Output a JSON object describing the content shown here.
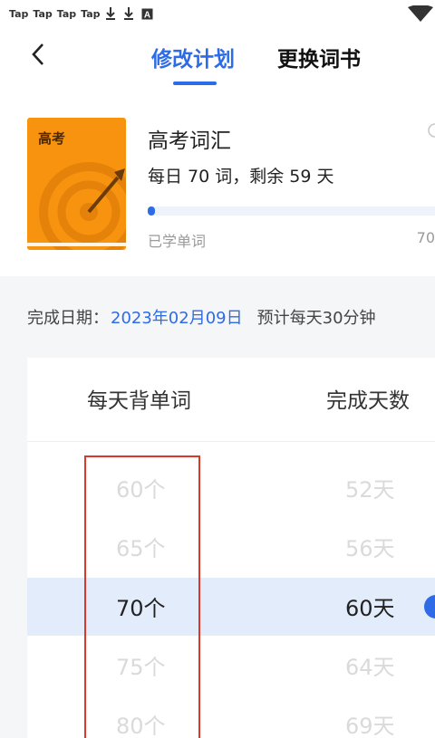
{
  "status_bar": {
    "tap_labels": [
      "Tap",
      "Tap",
      "Tap",
      "Tap"
    ],
    "icons": [
      "download-icon",
      "download-icon",
      "notification-a-icon",
      "wifi-icon"
    ]
  },
  "nav": {
    "back_icon": "back-chevron-icon",
    "tabs": [
      {
        "label": "修改计划",
        "active": true
      },
      {
        "label": "更换词书",
        "active": false
      }
    ]
  },
  "book": {
    "cover_title": "高考",
    "name": "高考词汇",
    "plan_text": "每日 70 词，剩余 59 天",
    "progress": 0.02,
    "learned_label": "已学单词",
    "total_value": "70"
  },
  "finish": {
    "label": "完成日期：",
    "date": "2023年02月09日",
    "time": "预计每天30分钟"
  },
  "picker": {
    "header_left": "每天背单词",
    "header_right": "完成天数",
    "rows": [
      {
        "left": "60个",
        "right": "52天"
      },
      {
        "left": "65个",
        "right": "56天"
      },
      {
        "left": "70个",
        "right": "60天",
        "selected": true
      },
      {
        "left": "75个",
        "right": "64天"
      },
      {
        "left": "80个",
        "right": "69天"
      }
    ]
  },
  "colors": {
    "accent": "#2e6be6",
    "book_cover": "#f7930f",
    "highlight_box": "#d9382b",
    "selected_band": "#e2ecfb"
  }
}
